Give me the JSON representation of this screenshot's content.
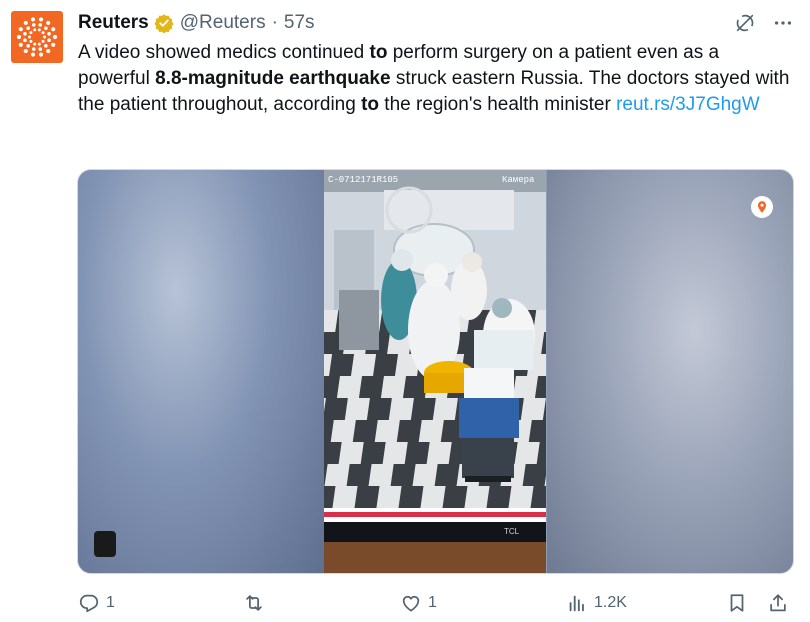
{
  "tweet": {
    "author_name": "Reuters",
    "handle": "@Reuters",
    "separator": "·",
    "time": "57s",
    "text_segments": [
      {
        "t": "A video showed medics continued ",
        "bold": false
      },
      {
        "t": "to",
        "bold": true
      },
      {
        "t": " perform surgery on a patient even as a powerful ",
        "bold": false
      },
      {
        "t": "8.8-magnitude earthquake",
        "bold": true
      },
      {
        "t": " struck eastern Russia. The doctors stayed with the patient throughout, according ",
        "bold": false
      },
      {
        "t": "to",
        "bold": true
      },
      {
        "t": " the region's health minister ",
        "bold": false
      }
    ],
    "link": "reut.rs/3J7GhgW"
  },
  "video": {
    "overlay_text_left": "C-0712171R105",
    "overlay_text_right": "Камера",
    "monitor_brand": "TCL"
  },
  "actions": {
    "replies": "1",
    "reposts": "",
    "likes": "1",
    "views": "1.2K"
  },
  "colors": {
    "accent": "#1d9bf0",
    "brand": "#f26722",
    "verified": "#e2b719",
    "muted": "#536471"
  },
  "icons": [
    "reuters-logo-icon",
    "verified-badge-icon",
    "grok-icon",
    "more-icon",
    "location-pin-icon",
    "reply-icon",
    "repost-icon",
    "like-icon",
    "views-icon",
    "bookmark-icon",
    "share-icon"
  ]
}
